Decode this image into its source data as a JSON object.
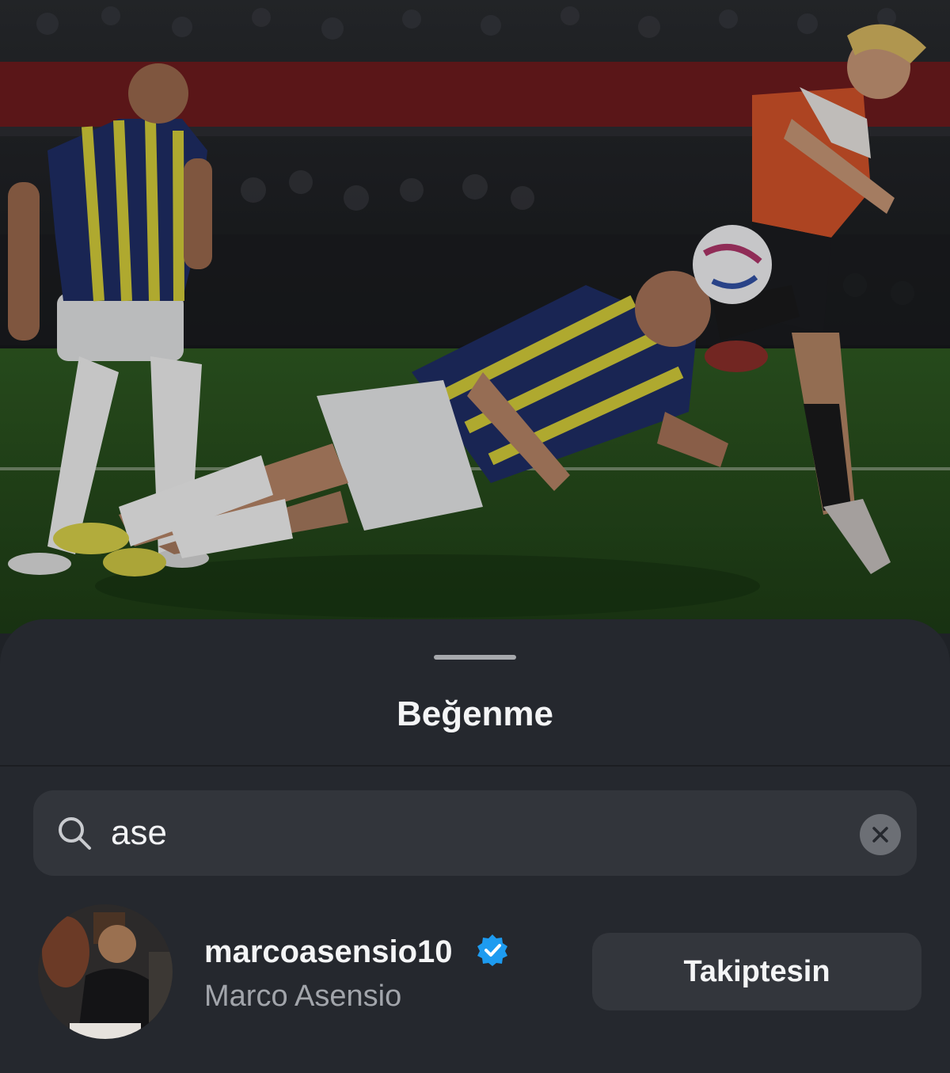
{
  "post_image": {
    "subject": "football-match-photo"
  },
  "likes_sheet": {
    "title": "Beğenme",
    "search": {
      "value": "ase",
      "icon": "search-icon",
      "clear_icon": "clear-icon"
    },
    "results": [
      {
        "username": "marcoasensio10",
        "full_name": "Marco Asensio",
        "verified": true,
        "button_label": "Takiptesin"
      }
    ]
  },
  "colors": {
    "sheet_background": "#25282e",
    "search_background": "#32353b",
    "verified_badge": "#1d9bf0",
    "button_background": "#33363c"
  }
}
